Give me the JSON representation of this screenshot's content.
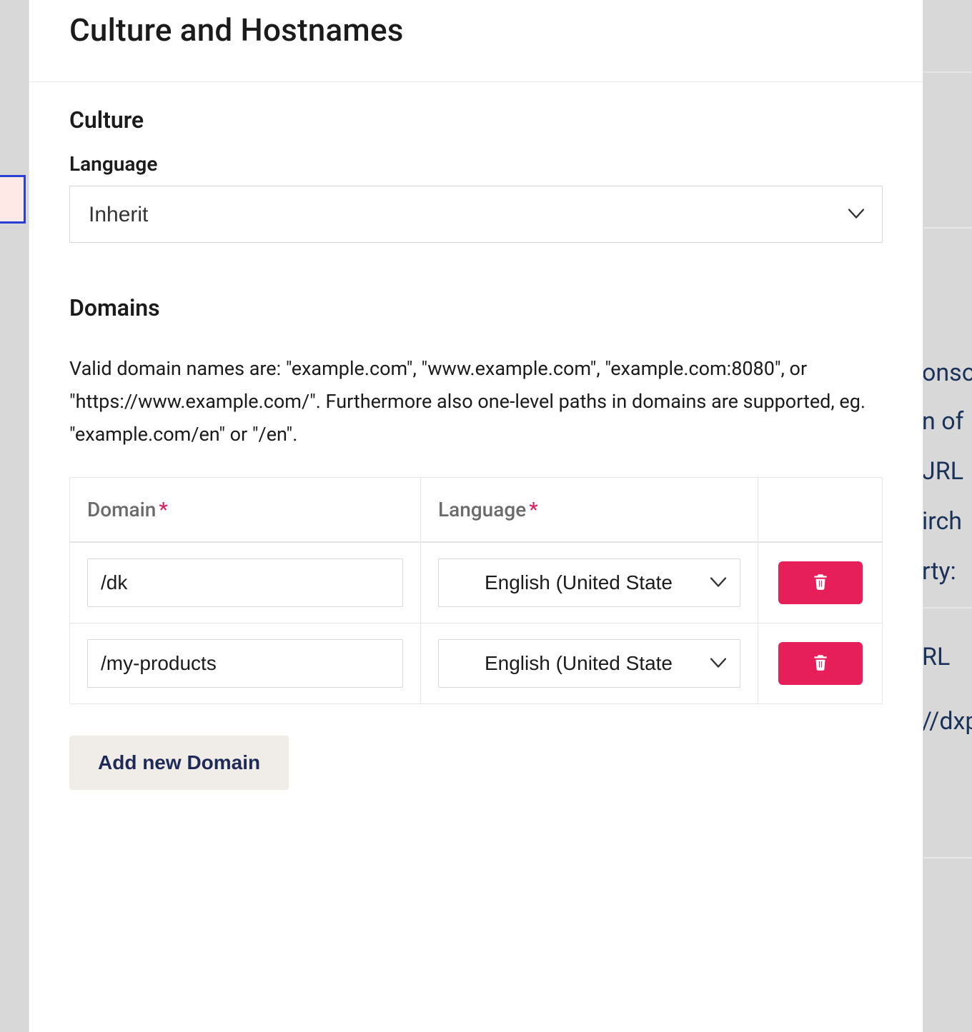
{
  "dialog": {
    "title": "Culture and Hostnames"
  },
  "culture": {
    "section_title": "Culture",
    "language_label": "Language",
    "language_value": "Inherit"
  },
  "domains": {
    "section_title": "Domains",
    "valid_names_text": "Valid domain names are: \"example.com\", \"www.example.com\", \"example.com:8080\", or \"https://www.example.com/\". Furthermore also one-level paths in domains are supported, eg. \"example.com/en\" or \"/en\".",
    "col_domain": "Domain",
    "col_language": "Language",
    "required_marker": "*",
    "rows": [
      {
        "domain": "/dk",
        "language": "English (United State"
      },
      {
        "domain": "/my-products",
        "language": "English (United State"
      }
    ],
    "add_button": "Add new Domain"
  },
  "background_fragments": {
    "f0": "onso",
    "f1": "n of",
    "f2": "JRL",
    "f3": "irch",
    "f4": "rty:",
    "f5": "RL",
    "f6": "//dxp"
  },
  "colors": {
    "danger": "#e61e5a",
    "accent_text": "#1f2a56",
    "required": "#d6245f"
  }
}
